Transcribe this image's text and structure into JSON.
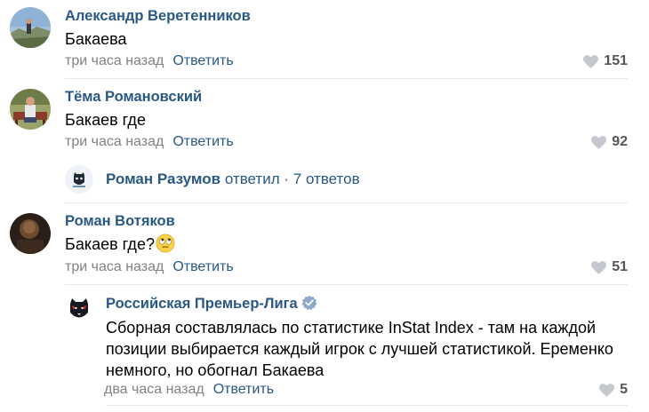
{
  "comments": [
    {
      "author": "Александр Веретенников",
      "text": "Бакаева",
      "time": "три часа назад",
      "reply": "Ответить",
      "likes": "151",
      "avatar_icon": "landscape-photo"
    },
    {
      "author": "Тёма Романовский",
      "text": "Бакаев где",
      "time": "три часа назад",
      "reply": "Ответить",
      "likes": "92",
      "avatar_icon": "person-on-bench-photo"
    },
    {
      "author": "Роман Вотяков",
      "text": "Бакаев где?",
      "time": "три часа назад",
      "reply": "Ответить",
      "likes": "51",
      "avatar_icon": "dark-portrait-photo",
      "emoji": "face-with-rolling-eyes"
    }
  ],
  "thread": {
    "name": "Роман Разумов",
    "replied": "ответил",
    "dot": "·",
    "replies_count": "7 ответов"
  },
  "reply": {
    "author": "Российская Премьер-Лига",
    "lines": [
      "Сборная составлялась по статистике InStat Index - там на каждой",
      "позиции выбирается каждый игрок с лучшей статистикой. Еременко",
      "немного, но обогнал Бакаева"
    ],
    "time": "два часа назад",
    "reply": "Ответить",
    "likes": "5",
    "avatar_icon": "rpl-bear-logo",
    "verified": true
  },
  "colors": {
    "link": "#2a5885",
    "meta": "#828282",
    "separator": "#e7e8ec",
    "heart": "#c5c9cf"
  }
}
